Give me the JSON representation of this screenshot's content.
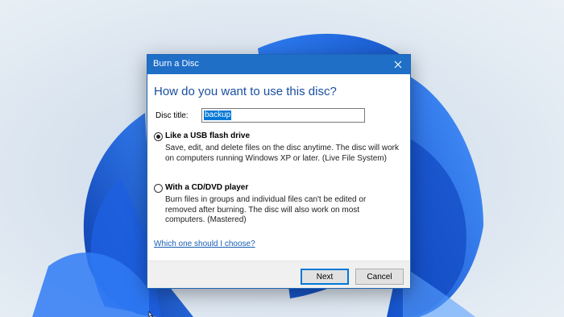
{
  "dialog": {
    "title": "Burn a Disc",
    "close_icon": "close-icon",
    "heading": "How do you want to use this disc?",
    "disc_title_label": "Disc title:",
    "disc_title_value": "backup",
    "options": [
      {
        "title": "Like a USB flash drive",
        "description": "Save, edit, and delete files on the disc anytime. The disc will work on computers running Windows XP or later. (Live File System)",
        "selected": true
      },
      {
        "title": "With a CD/DVD player",
        "description": "Burn files in groups and individual files can't be edited or removed after burning. The disc will also work on most computers. (Mastered)",
        "selected": false
      }
    ],
    "help_link": "Which one should I choose?",
    "buttons": {
      "next": "Next",
      "cancel": "Cancel"
    }
  },
  "colors": {
    "titlebar": "#1f6fc7",
    "heading": "#1a4fa0",
    "link": "#1a5fb4",
    "selection": "#0078d7"
  }
}
